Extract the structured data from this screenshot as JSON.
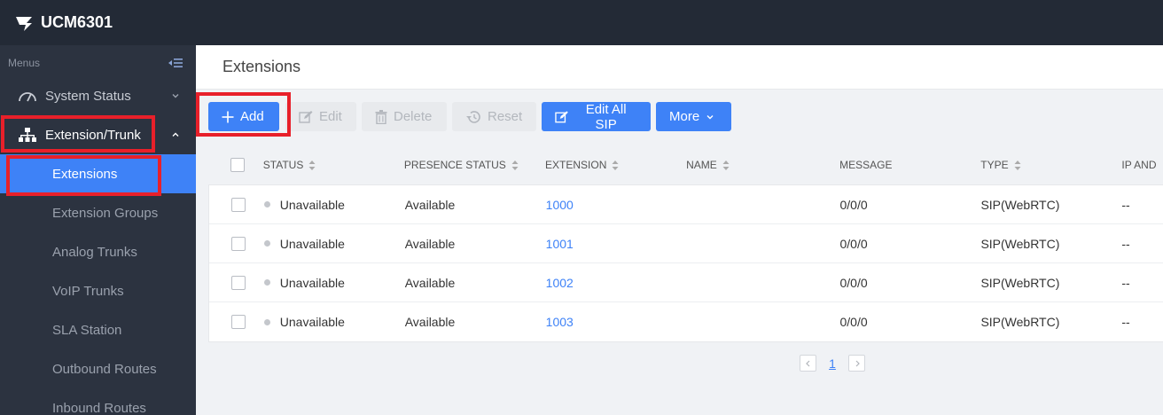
{
  "app": {
    "title": "UCM6301"
  },
  "sidebar": {
    "menus_label": "Menus",
    "items": [
      {
        "label": "System Status",
        "icon": "gauge-icon"
      },
      {
        "label": "Extension/Trunk",
        "icon": "network-icon"
      }
    ],
    "sub_items": [
      {
        "label": "Extensions"
      },
      {
        "label": "Extension Groups"
      },
      {
        "label": "Analog Trunks"
      },
      {
        "label": "VoIP Trunks"
      },
      {
        "label": "SLA Station"
      },
      {
        "label": "Outbound Routes"
      },
      {
        "label": "Inbound Routes"
      }
    ]
  },
  "page": {
    "title": "Extensions"
  },
  "toolbar": {
    "add": "Add",
    "edit": "Edit",
    "delete": "Delete",
    "reset": "Reset",
    "edit_all_sip": "Edit All SIP",
    "more": "More"
  },
  "table": {
    "columns": [
      "STATUS",
      "PRESENCE STATUS",
      "EXTENSION",
      "NAME",
      "MESSAGE",
      "TYPE",
      "IP AND"
    ],
    "rows": [
      {
        "status": "Unavailable",
        "presence": "Available",
        "extension": "1000",
        "name": "",
        "message": "0/0/0",
        "type": "SIP(WebRTC)",
        "ip": "--"
      },
      {
        "status": "Unavailable",
        "presence": "Available",
        "extension": "1001",
        "name": "",
        "message": "0/0/0",
        "type": "SIP(WebRTC)",
        "ip": "--"
      },
      {
        "status": "Unavailable",
        "presence": "Available",
        "extension": "1002",
        "name": "",
        "message": "0/0/0",
        "type": "SIP(WebRTC)",
        "ip": "--"
      },
      {
        "status": "Unavailable",
        "presence": "Available",
        "extension": "1003",
        "name": "",
        "message": "0/0/0",
        "type": "SIP(WebRTC)",
        "ip": "--"
      }
    ]
  },
  "pagination": {
    "current_page": "1"
  },
  "colors": {
    "accent": "#3e82f7",
    "sidebar": "#2c3340",
    "topbar": "#232a36",
    "highlight": "#e8202a"
  }
}
